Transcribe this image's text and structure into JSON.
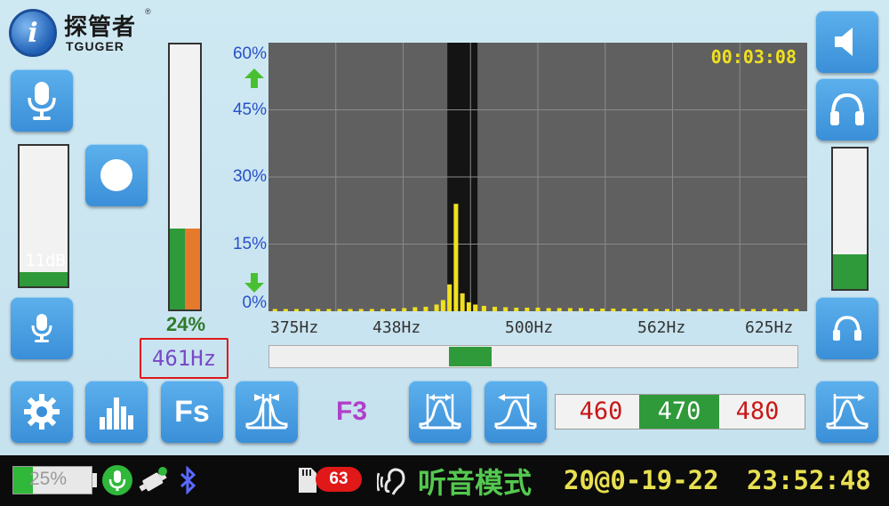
{
  "logo": {
    "cn": "探管者",
    "en": "TGUGER",
    "reg": "®",
    "letter": "i"
  },
  "left_meter": {
    "label": "11dB",
    "level": 0.1
  },
  "center_meter": {
    "label": "24%",
    "level": 0.24
  },
  "right_meter": {
    "level": 0.25
  },
  "freq_readout": "461Hz",
  "timer": "00:03:08",
  "chart_data": {
    "type": "bar",
    "x_ticks": [
      "375Hz",
      "438Hz",
      "500Hz",
      "562Hz",
      "625Hz"
    ],
    "xlim": [
      375,
      625
    ],
    "y_ticks": [
      "60%",
      "45%",
      "30%",
      "15%",
      "0%"
    ],
    "ylim": [
      0,
      60
    ],
    "highlight_band": [
      458,
      472
    ],
    "x": [
      378,
      383,
      388,
      393,
      398,
      403,
      408,
      413,
      418,
      423,
      428,
      433,
      438,
      443,
      448,
      453,
      456,
      459,
      462,
      465,
      468,
      471,
      475,
      480,
      485,
      490,
      495,
      500,
      505,
      510,
      515,
      520,
      525,
      530,
      535,
      540,
      545,
      550,
      555,
      560,
      565,
      570,
      575,
      580,
      585,
      590,
      595,
      600,
      605,
      610,
      615,
      620
    ],
    "values": [
      0.5,
      0.5,
      0.5,
      0.5,
      0.5,
      0.5,
      0.5,
      0.5,
      0.5,
      0.5,
      0.5,
      0.6,
      0.7,
      0.9,
      1.0,
      1.5,
      2.5,
      6,
      24,
      4,
      2,
      1.5,
      1.2,
      1.0,
      0.9,
      0.8,
      0.8,
      0.8,
      0.7,
      0.7,
      0.7,
      0.7,
      0.6,
      0.6,
      0.6,
      0.6,
      0.6,
      0.6,
      0.5,
      0.5,
      0.5,
      0.5,
      0.5,
      0.5,
      0.5,
      0.5,
      0.5,
      0.5,
      0.5,
      0.5,
      0.5,
      0.5
    ],
    "bar_color": "#f0e020",
    "grid": true
  },
  "slider": {
    "position": 0.34
  },
  "filter_label": "F3",
  "freq_options": [
    "460",
    "470",
    "480"
  ],
  "freq_selected": 1,
  "fs_label": "Fs",
  "status": {
    "battery_label": "25%",
    "battery_level": 0.25,
    "badge_count": "63",
    "mode_label": "听音模式",
    "date": "20@0-19-22",
    "time": "23:52:48"
  },
  "colors": {
    "accent": "#3a8fd8",
    "green": "#2f9a3a",
    "orange": "#e67a2c",
    "yellow": "#f0e020"
  }
}
